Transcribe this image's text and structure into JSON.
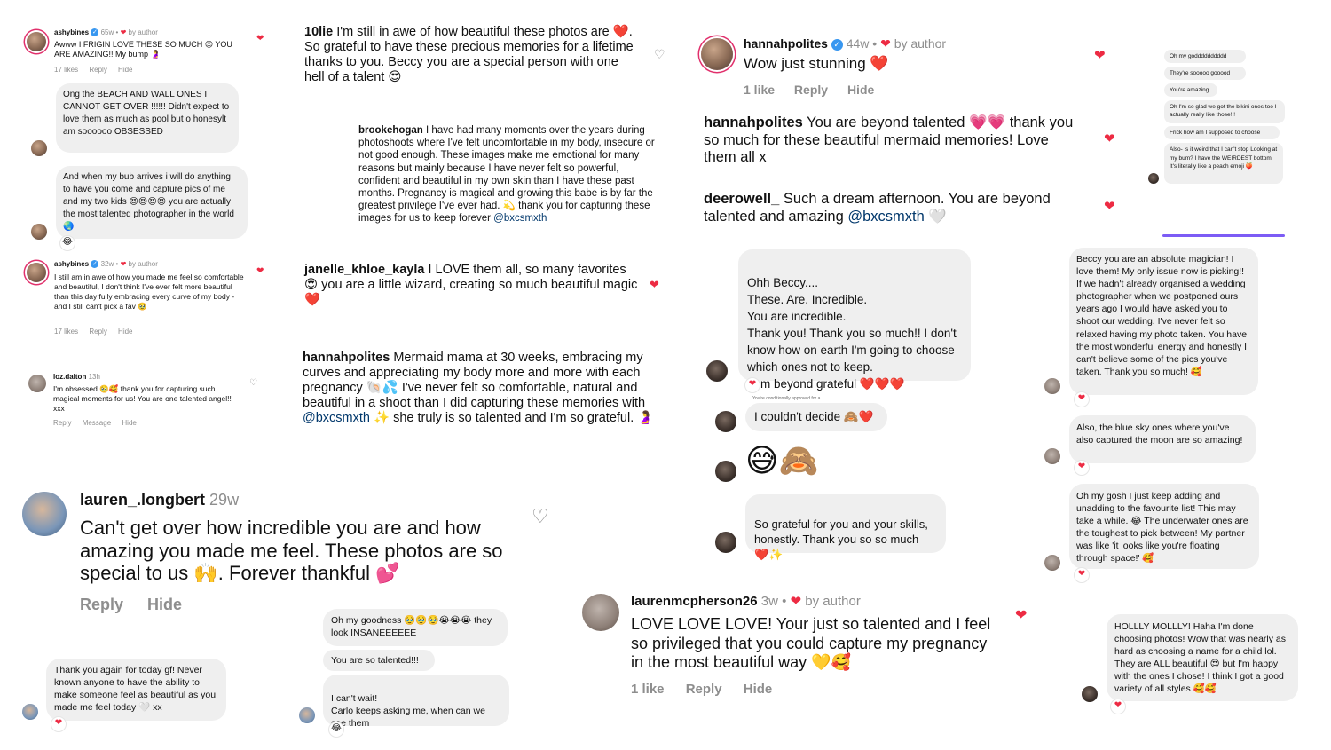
{
  "c1": {
    "user": "ashybines",
    "time": "65w",
    "author_tag": "by author",
    "text": "Awww I FRIGIN LOVE THESE SO MUCH 😍 YOU ARE AMAZING!! My bump 🤰",
    "likes": "17 likes",
    "reply": "Reply",
    "hide": "Hide"
  },
  "b1": "Ong the BEACH AND WALL ONES I CANNOT GET OVER !!!!!! Didn't expect to love them as much as pool but o honesylt am soooooo OBSESSED",
  "b2": "And when my bub arrives i will do anything to have you come and capture pics of me and my two kids 😍😍😍😍 you are actually the most talented photographer in the world 🌏",
  "b2_react": "😂",
  "c2": {
    "user": "ashybines",
    "time": "32w",
    "author_tag": "by author",
    "text": "I still am in awe of how you made me feel so comfortable and beautiful, I don't think I've ever felt more beautiful than this day fully embracing every curve of my body - and I still can't pick a fav 🥹",
    "likes": "17 likes",
    "reply": "Reply",
    "hide": "Hide"
  },
  "c3": {
    "user": "loz.dalton",
    "time": "13h",
    "text": "I'm obsessed 🥹🥰 thank you for capturing such magical moments for us! You are one talented angel!! xxx",
    "reply": "Reply",
    "message": "Message",
    "hide": "Hide"
  },
  "c4": {
    "user": "10lie",
    "text": "I'm still in awe of how beautiful these photos are ❤️. So grateful to have these precious memories for a lifetime thanks to you. Beccy you are a special person with one hell of a talent 😍"
  },
  "c5": {
    "user": "brookehogan",
    "text": "I have had many moments over the years during photoshoots where I've felt uncomfortable in my body, insecure or not good enough. These images make me emotional for many reasons but mainly because I have never felt so powerful, confident and beautiful in my own skin than I have these past months. Pregnancy is magical and growing this babe is by far the greatest privilege I've ever had. 💫 thank you for capturing these images for us to keep forever",
    "mention": "@bxcsmxth"
  },
  "c6": {
    "user": "janelle_khloe_kayla",
    "text": "I LOVE them all, so many favorites 😍 you are a little wizard, creating so much beautiful magic ❤️"
  },
  "c7": {
    "user": "hannahpolites",
    "text_a": "Mermaid mama at 30 weeks, embracing my curves and appreciating my body more and more with each pregnancy 🐚💦 I've never felt so comfortable, natural and beautiful in a shoot than I did capturing these memories with",
    "mention": "@bxcsmxth",
    "text_b": "✨ she truly is so talented and I'm so grateful. 🤰"
  },
  "c8": {
    "user": "lauren_.longbert",
    "time": "29w",
    "text": "Can't get over how incredible you are and how amazing you made me feel. These photos are so special to us 🙌. Forever thankful 💕",
    "reply": "Reply",
    "hide": "Hide"
  },
  "b3": "Thank you again for today gf! Never known anyone to have the ability to make someone feel as beautiful as you made me feel today 🤍 xx",
  "b4": "Oh my goodness 🥹🥹🥹😭😭😭 they look INSANEEEEEE",
  "b5": "You are so talented!!!",
  "b6": "I can't wait!\nCarlo keeps asking me, when can we see them",
  "b6_react": "😂",
  "c9": {
    "user": "hannahpolites",
    "time": "44w",
    "author_tag": "by author",
    "text": "Wow just stunning ❤️",
    "likes": "1 like",
    "reply": "Reply",
    "hide": "Hide"
  },
  "c10": {
    "user": "hannahpolites",
    "text": "You are beyond talented 💗💗 thank you so much for these beautiful mermaid memories! Love them all x"
  },
  "c11": {
    "user": "deerowell_",
    "text": "Such a dream afternoon. You are beyond talented and amazing",
    "mention": "@bxcsmxth",
    "emoji": "🤍"
  },
  "b7": "Ohh Beccy....\nThese. Are. Incredible.\nYou are incredible.\nThank you! Thank you so much!! I don't know how on earth I'm going to choose which ones not to keep.\nI am beyond grateful ❤️❤️❤️",
  "small_label": "You're conditionally approved for a",
  "b8": "I couldn't decide 🙈❤️",
  "b9": "😅🙈",
  "b10": "So grateful for you and your skills, honestly. Thank you so so much\n❤️✨",
  "mini": [
    "Oh my godddddddddd",
    "They're sooooo gooood",
    "You're amazing",
    "Oh I'm so glad we got the bikini ones too I actually really like those!!!",
    "Frick how am I supposed to choose",
    "Also- is it weird that I can't stop Looking at my bum? I have the WEIRDEST bottom! It's literally like a peach emoji 🍑"
  ],
  "b11": "Beccy you are an absolute magician! I love them! My only issue now is picking!! If we hadn't already organised a wedding photographer when we postponed ours years ago I would have asked you to shoot our wedding. I've never felt so relaxed having my photo taken. You have the most wonderful energy and honestly I can't believe some of the pics you've taken. Thank you so much! 🥰",
  "b12": "Also, the blue sky ones where you've also captured the moon are so amazing!",
  "b13": "Oh my gosh I just keep adding and unadding to the favourite list! This may take a while. 😂 The underwater ones are the toughest to pick between! My partner was like 'it looks like you're floating through space!' 🥰",
  "c12": {
    "user": "laurenmcpherson26",
    "time": "3w",
    "author_tag": "by author",
    "text": "LOVE LOVE LOVE! Your just so talented and I feel so privileged that you could capture my pregnancy in the most beautiful way 💛🥰",
    "likes": "1 like",
    "reply": "Reply",
    "hide": "Hide"
  },
  "b14": "HOLLLY MOLLLY! Haha I'm done choosing photos! Wow that was nearly as hard as choosing a name for a child lol. They are ALL beautiful 😍 but I'm happy with the ones I chose! I think I got a good variety of all styles 🥰🥰",
  "icons": {
    "heart": "❤",
    "heart_outline": "♡",
    "dot": "•",
    "check": "✓"
  }
}
